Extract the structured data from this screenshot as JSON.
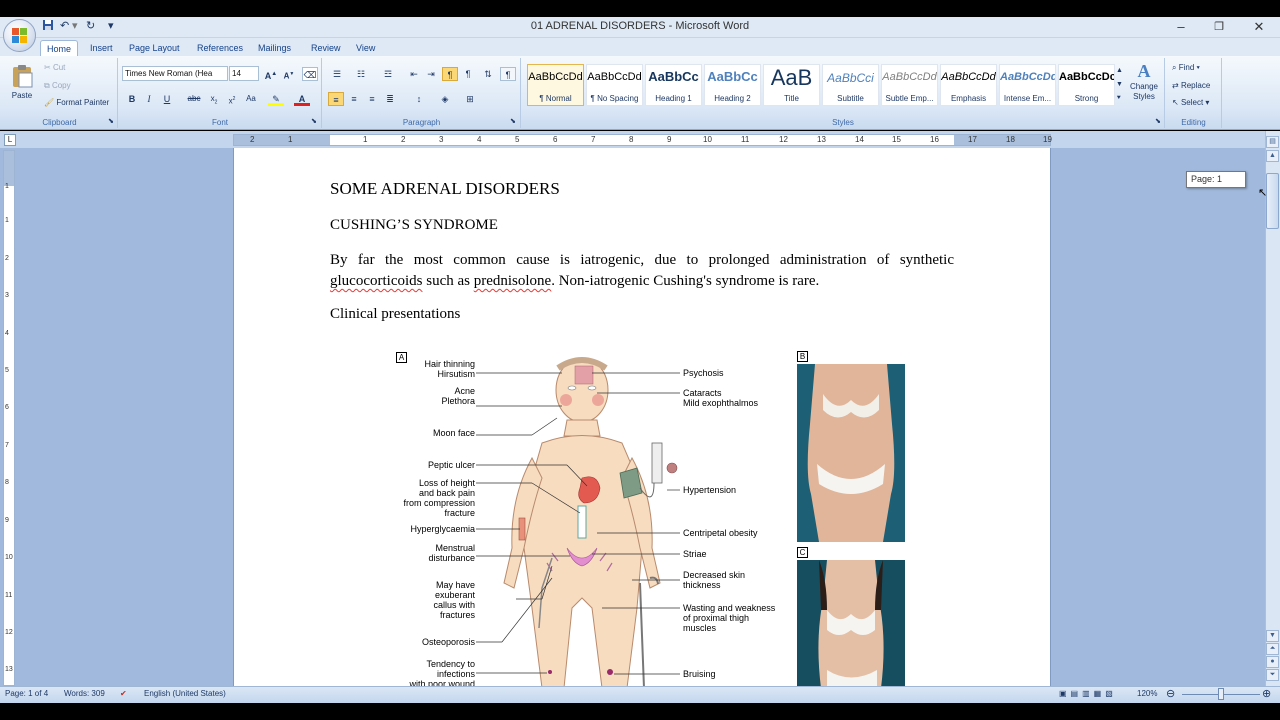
{
  "window": {
    "title": "01 ADRENAL DISORDERS - Microsoft Word",
    "controls": {
      "minimize": "–",
      "restore": "❐",
      "close": "✕"
    }
  },
  "tabs": [
    "Home",
    "Insert",
    "Page Layout",
    "References",
    "Mailings",
    "Review",
    "View"
  ],
  "ribbon": {
    "clipboard": {
      "paste": "Paste",
      "cut": "Cut",
      "copy": "Copy",
      "format_painter": "Format Painter",
      "label": "Clipboard"
    },
    "font": {
      "name": "Times New Roman (Hea",
      "size": "14",
      "label": "Font"
    },
    "paragraph": {
      "label": "Paragraph"
    },
    "styles": {
      "label": "Styles",
      "items": [
        {
          "sample": "AaBbCcDd",
          "name": "¶ Normal"
        },
        {
          "sample": "AaBbCcDd",
          "name": "¶ No Spacing"
        },
        {
          "sample": "AaBbCc",
          "name": "Heading 1"
        },
        {
          "sample": "AaBbCc",
          "name": "Heading 2"
        },
        {
          "sample": "AaB",
          "name": "Title"
        },
        {
          "sample": "AaBbCci",
          "name": "Subtitle"
        },
        {
          "sample": "AaBbCcDd",
          "name": "Subtle Emp..."
        },
        {
          "sample": "AaBbCcDd",
          "name": "Emphasis"
        },
        {
          "sample": "AaBbCcDd",
          "name": "Intense Em..."
        },
        {
          "sample": "AaBbCcDc",
          "name": "Strong"
        }
      ],
      "change_styles": "Change Styles"
    },
    "editing": {
      "find": "Find",
      "replace": "Replace",
      "select": "Select",
      "label": "Editing"
    }
  },
  "ruler": {
    "tab_selector": "L",
    "h_numbers": [
      "2",
      "1",
      "1",
      "2",
      "3",
      "4",
      "5",
      "6",
      "7",
      "8",
      "9",
      "10",
      "11",
      "12",
      "13",
      "14",
      "15",
      "16",
      "17",
      "18",
      "19"
    ],
    "v_numbers": [
      "1",
      "1",
      "2",
      "3",
      "4",
      "5",
      "6",
      "7",
      "8",
      "9",
      "10",
      "11",
      "12",
      "13"
    ]
  },
  "document": {
    "heading": "SOME ADRENAL DISORDERS",
    "subheading": "CUSHING’S SYNDROME",
    "para1_a": "By far the most common cause is iatrogenic, due to prolonged administration of synthetic ",
    "para1_b": "glucocorticoids",
    "para1_c": " such as ",
    "para1_d": "prednisolone",
    "para1_e": ". Non-iatrogenic Cushing's syndrome is rare.",
    "para2": "Clinical presentations",
    "figure": {
      "panel_a": "A",
      "panel_b": "B",
      "panel_c": "C",
      "left_labels": [
        "Hair thinning\nHirsutism",
        "Acne\nPlethora",
        "Moon face",
        "Peptic ulcer",
        "Loss of height\nand back pain\nfrom compression\nfracture",
        "Hyperglycaemia",
        "Menstrual\ndisturbance",
        "May have\nexuberant\ncallus with\nfractures",
        "Osteoporosis",
        "Tendency to\ninfections\nwith poor wound"
      ],
      "right_labels": [
        "Psychosis",
        "Cataracts\nMild exophthalmos",
        "Hypertension",
        "Centripetal obesity",
        "Striae",
        "Decreased skin\nthickness",
        "Wasting and weakness\nof proximal thigh\nmuscles",
        "Bruising"
      ]
    }
  },
  "scroll": {
    "page_tooltip": "Page: 1"
  },
  "status": {
    "page": "Page: 1 of 4",
    "words": "Words: 309",
    "language": "English (United States)",
    "zoom": "120%"
  },
  "colors": {
    "workspace": "#a0b9dc",
    "ribbon": "#dce8f6",
    "photo_bg": "#1d5f74",
    "skin": "#f7dcc0",
    "spell_error": "#e53935"
  }
}
